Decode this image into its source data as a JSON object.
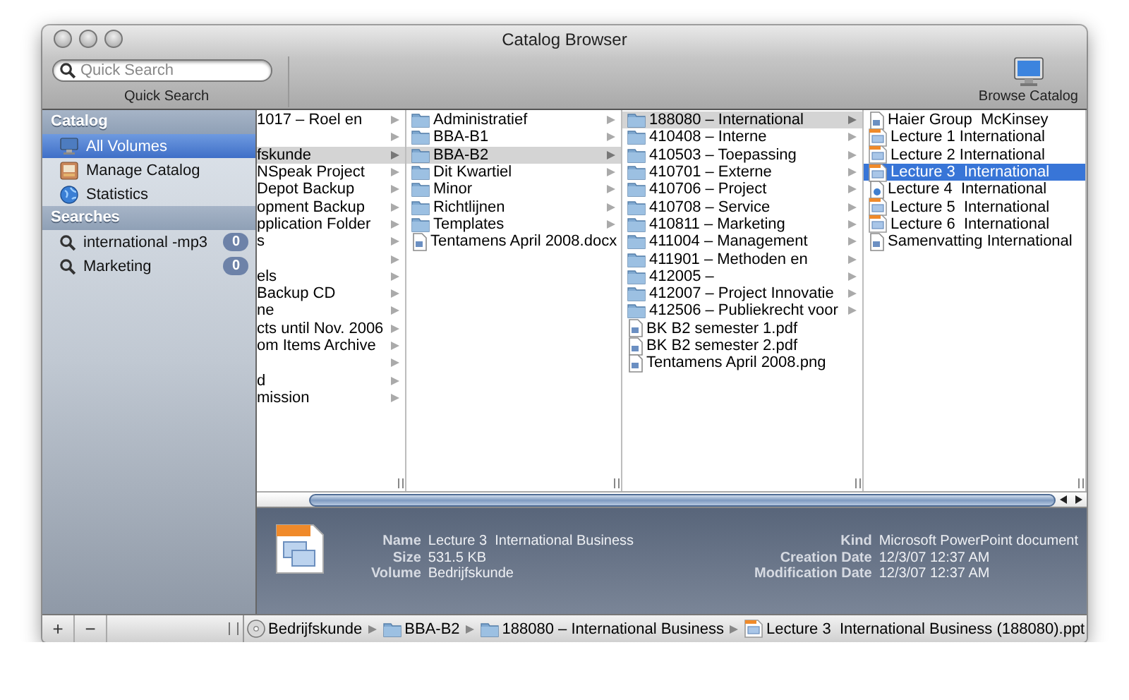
{
  "window": {
    "title": "Catalog Browser"
  },
  "toolbar": {
    "search": {
      "placeholder": "Quick Search",
      "label": "Quick Search"
    },
    "browse_button": {
      "label": "Browse Catalog"
    }
  },
  "sidebar": {
    "sections": [
      {
        "title": "Catalog",
        "items": [
          {
            "label": "All Volumes",
            "kind": "volumes",
            "selected": true
          },
          {
            "label": "Manage Catalog",
            "kind": "catalog",
            "selected": false
          },
          {
            "label": "Statistics",
            "kind": "globe",
            "selected": false
          }
        ]
      },
      {
        "title": "Searches",
        "items": [
          {
            "label": "international -mp3",
            "kind": "search",
            "badge": "0",
            "selected": false
          },
          {
            "label": "Marketing",
            "kind": "search",
            "badge": "0",
            "selected": false
          }
        ]
      }
    ]
  },
  "columns": [
    {
      "active": false,
      "items": [
        {
          "label": "1017 – Roel en",
          "expandable": true,
          "selected": false
        },
        {
          "expandable": true,
          "selected": false
        },
        {
          "label": "fskunde",
          "expandable": true,
          "selected": true
        },
        {
          "label": "NSpeak Project",
          "expandable": true,
          "selected": false
        },
        {
          "label": "Depot Backup",
          "expandable": true,
          "selected": false
        },
        {
          "label": "opment Backup",
          "expandable": true,
          "selected": false
        },
        {
          "label": "pplication Folder",
          "expandable": true,
          "selected": false
        },
        {
          "label": "s",
          "expandable": true,
          "selected": false
        },
        {
          "expandable": true,
          "selected": false
        },
        {
          "label": "els",
          "expandable": true,
          "selected": false
        },
        {
          "label": "Backup CD",
          "expandable": true,
          "selected": false
        },
        {
          "label": "ne",
          "expandable": true,
          "selected": false
        },
        {
          "label": "cts until Nov. 2006",
          "expandable": true,
          "selected": false
        },
        {
          "label": "om Items Archive",
          "expandable": true,
          "selected": false
        },
        {
          "expandable": true,
          "selected": false
        },
        {
          "label": "d",
          "expandable": true,
          "selected": false
        },
        {
          "label": "mission",
          "expandable": true,
          "selected": false
        }
      ]
    },
    {
      "active": false,
      "items": [
        {
          "label": "Administratief",
          "kind": "folder",
          "expandable": true,
          "selected": false
        },
        {
          "label": "BBA-B1",
          "kind": "folder",
          "expandable": true,
          "selected": false
        },
        {
          "label": "BBA-B2",
          "kind": "folder",
          "expandable": true,
          "selected": true
        },
        {
          "label": "Dit Kwartiel",
          "kind": "folder",
          "expandable": true,
          "selected": false
        },
        {
          "label": "Minor",
          "kind": "folder",
          "expandable": true,
          "selected": false
        },
        {
          "label": "Richtlijnen",
          "kind": "folder",
          "expandable": true,
          "selected": false
        },
        {
          "label": "Templates",
          "kind": "folder",
          "expandable": true,
          "selected": false
        },
        {
          "label": "Tentamens April 2008.docx",
          "kind": "doc",
          "expandable": false,
          "selected": false
        }
      ]
    },
    {
      "active": false,
      "items": [
        {
          "label": "188080 – International",
          "kind": "folder",
          "expandable": true,
          "selected": true
        },
        {
          "label": "410408 – Interne",
          "kind": "folder",
          "expandable": true,
          "selected": false
        },
        {
          "label": "410503 – Toepassing",
          "kind": "folder",
          "expandable": true,
          "selected": false
        },
        {
          "label": "410701 – Externe",
          "kind": "folder",
          "expandable": true,
          "selected": false
        },
        {
          "label": "410706 – Project",
          "kind": "folder",
          "expandable": true,
          "selected": false
        },
        {
          "label": "410708 – Service",
          "kind": "folder",
          "expandable": true,
          "selected": false
        },
        {
          "label": "410811 – Marketing",
          "kind": "folder",
          "expandable": true,
          "selected": false
        },
        {
          "label": "411004 – Management",
          "kind": "folder",
          "expandable": true,
          "selected": false
        },
        {
          "label": "411901 – Methoden en",
          "kind": "folder",
          "expandable": true,
          "selected": false
        },
        {
          "label": "412005 –",
          "kind": "folder",
          "expandable": true,
          "selected": false
        },
        {
          "label": "412007 – Project Innovatie",
          "kind": "folder",
          "expandable": true,
          "selected": false
        },
        {
          "label": "412506 – Publiekrecht voor",
          "kind": "folder",
          "expandable": true,
          "selected": false
        },
        {
          "label": "BK B2 semester 1.pdf",
          "kind": "doc",
          "expandable": false,
          "selected": false
        },
        {
          "label": "BK B2 semester 2.pdf",
          "kind": "doc",
          "expandable": false,
          "selected": false
        },
        {
          "label": "Tentamens April 2008.png",
          "kind": "doc",
          "expandable": false,
          "selected": false
        }
      ]
    },
    {
      "active": true,
      "items": [
        {
          "label": "Haier Group  McKinsey",
          "kind": "doc",
          "expandable": false,
          "selected": false
        },
        {
          "label": "Lecture 1 International",
          "kind": "ppt",
          "expandable": false,
          "selected": false
        },
        {
          "label": "Lecture 2 International",
          "kind": "ppt",
          "expandable": false,
          "selected": false
        },
        {
          "label": "Lecture 3  International",
          "kind": "ppt",
          "expandable": false,
          "selected": true
        },
        {
          "label": "Lecture 4  International",
          "kind": "slides",
          "expandable": false,
          "selected": false
        },
        {
          "label": "Lecture 5  International",
          "kind": "ppt",
          "expandable": false,
          "selected": false
        },
        {
          "label": "Lecture 6  International",
          "kind": "ppt",
          "expandable": false,
          "selected": false
        },
        {
          "label": "Samenvatting International",
          "kind": "doc",
          "expandable": false,
          "selected": false
        }
      ]
    }
  ],
  "info": {
    "left": [
      {
        "label": "Name",
        "value": "Lecture 3  International Business"
      },
      {
        "label": "Size",
        "value": "531.5 KB"
      },
      {
        "label": "Volume",
        "value": "Bedrijfskunde"
      }
    ],
    "right": [
      {
        "label": "Kind",
        "value": "Microsoft PowerPoint document"
      },
      {
        "label": "Creation Date",
        "value": "12/3/07 12:37 AM"
      },
      {
        "label": "Modification Date",
        "value": "12/3/07 12:37 AM"
      }
    ]
  },
  "bottom_bar": {
    "buttons": [
      "+",
      "−"
    ],
    "path": [
      {
        "label": "Bedrijfskunde",
        "kind": "disk"
      },
      {
        "label": "BBA-B2",
        "kind": "folder"
      },
      {
        "label": "188080 – International Business",
        "kind": "folder"
      },
      {
        "label": "Lecture 3  International Business (188080).ppt",
        "kind": "ppt"
      }
    ]
  }
}
